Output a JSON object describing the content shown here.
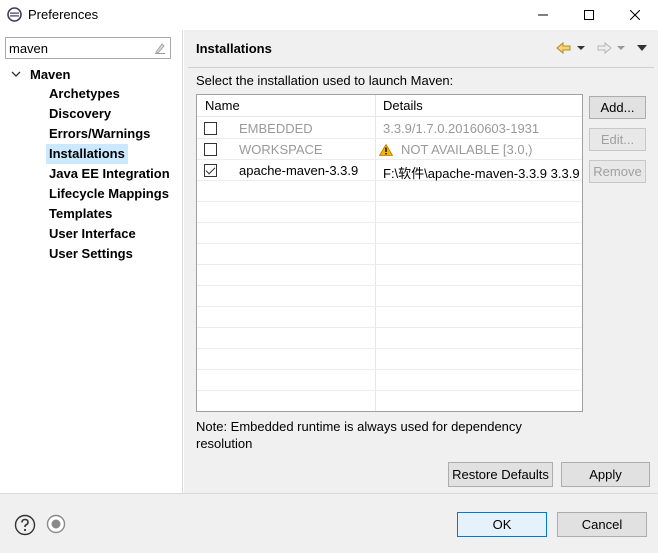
{
  "window": {
    "title": "Preferences"
  },
  "filter": {
    "value": "maven"
  },
  "tree": {
    "root": "Maven",
    "items": [
      {
        "label": "Archetypes"
      },
      {
        "label": "Discovery"
      },
      {
        "label": "Errors/Warnings"
      },
      {
        "label": "Installations",
        "selected": true
      },
      {
        "label": "Java EE Integration"
      },
      {
        "label": "Lifecycle Mappings"
      },
      {
        "label": "Templates"
      },
      {
        "label": "User Interface"
      },
      {
        "label": "User Settings"
      }
    ]
  },
  "page": {
    "title": "Installations",
    "instruction": "Select the installation used to launch Maven:",
    "columns": {
      "name": "Name",
      "details": "Details"
    },
    "rows": [
      {
        "checked": false,
        "enabled": false,
        "name": "EMBEDDED",
        "details": "3.3.9/1.7.0.20160603-1931"
      },
      {
        "checked": false,
        "enabled": false,
        "name": "WORKSPACE",
        "details": "NOT AVAILABLE [3.0,)",
        "icon": "warning-icon"
      },
      {
        "checked": true,
        "enabled": true,
        "name": "apache-maven-3.3.9",
        "details": "F:\\软件\\apache-maven-3.3.9 3.3.9"
      }
    ],
    "buttons": {
      "add": "Add...",
      "edit": "Edit...",
      "remove": "Remove"
    },
    "note": "Note: Embedded runtime is always used for dependency resolution",
    "restore_defaults": "Restore Defaults",
    "apply": "Apply"
  },
  "footer": {
    "ok": "OK",
    "cancel": "Cancel"
  },
  "colors": {
    "selection": "#cce8ff",
    "accent": "#0078d7",
    "warning": "#f5b400"
  }
}
